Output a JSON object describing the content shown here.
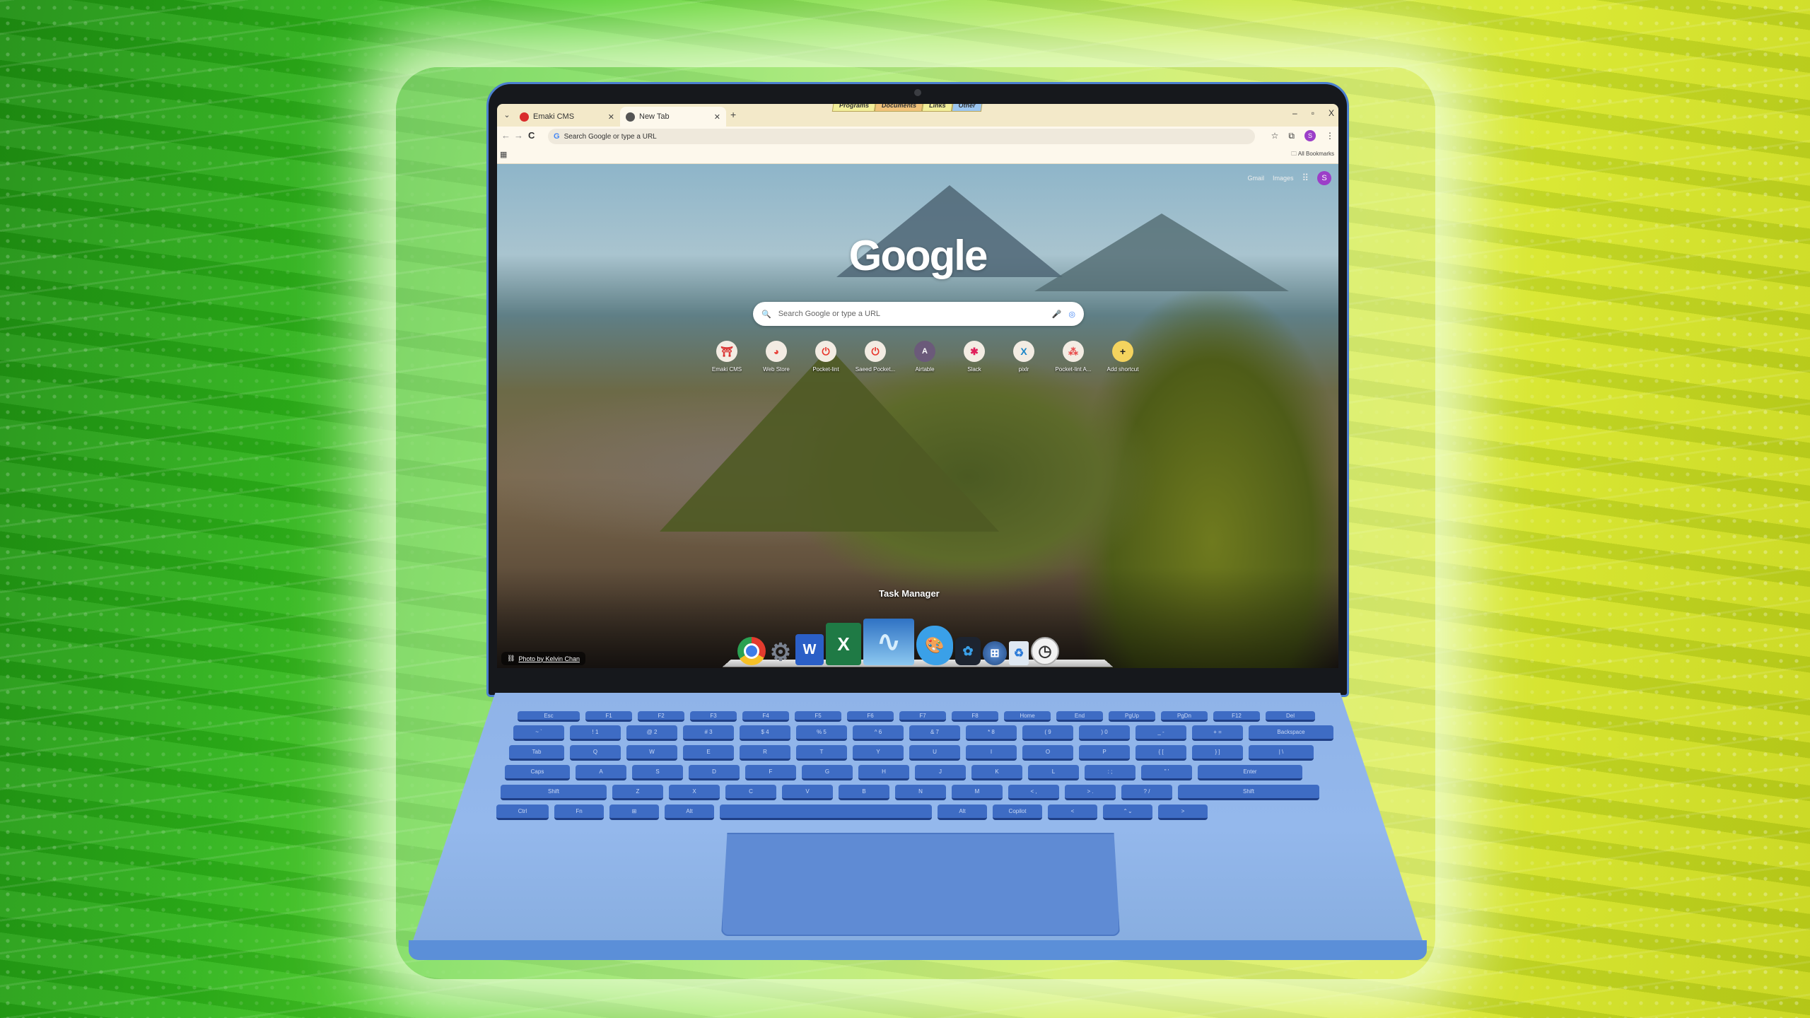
{
  "browser": {
    "tabs": [
      {
        "title": "Emaki CMS",
        "active": false,
        "favicon_color": "#d92b2b"
      },
      {
        "title": "New Tab",
        "active": true,
        "favicon_color": "#555555"
      }
    ],
    "tab_dropdown_icon": "chevron-down",
    "new_tab_icon": "+",
    "close_tab_icon": "x",
    "bookmark_folders_overlay": [
      {
        "label": "Programs",
        "color": "#f2ee9a"
      },
      {
        "label": "Documents",
        "color": "#f0c27a"
      },
      {
        "label": "Links",
        "color": "#f2ee9a"
      },
      {
        "label": "Other",
        "color": "#9cc6f0"
      }
    ],
    "window_controls": {
      "minimize": "–",
      "restore": "▫",
      "close": "X"
    },
    "nav": {
      "back": "←",
      "forward": "→",
      "reload": "C"
    },
    "omnibox": {
      "placeholder": "Search Google or type a URL",
      "value": ""
    },
    "toolbar_icons": [
      "star-icon",
      "extensions-icon",
      "profile-avatar",
      "menu-icon"
    ],
    "profile_initial": "S",
    "bookmarks_bar": {
      "all_bookmarks": "All Bookmarks"
    }
  },
  "ntp": {
    "top_links": [
      "Gmail",
      "Images"
    ],
    "profile_initial": "S",
    "logo": "Google",
    "search": {
      "placeholder": "Search Google or type a URL"
    },
    "shortcuts": [
      {
        "label": "Emaki CMS",
        "icon": "⛩",
        "color": "#d92b2b"
      },
      {
        "label": "Web Store",
        "icon": "◕",
        "color": "#e8453c"
      },
      {
        "label": "Pocket-lint",
        "icon": "⏻",
        "color": "#e8342a"
      },
      {
        "label": "Saeed Pocket...",
        "icon": "⏻",
        "color": "#e8342a"
      },
      {
        "label": "Airtable",
        "icon": "A",
        "color": "#6b5a7a"
      },
      {
        "label": "Slack",
        "icon": "✱",
        "color": "#e01e5a"
      },
      {
        "label": "pixlr",
        "icon": "X",
        "color": "#1c86c8"
      },
      {
        "label": "Pocket-lint A...",
        "icon": "⁂",
        "color": "#e84a4a"
      },
      {
        "label": "Add shortcut",
        "icon": "+",
        "color": "#222222"
      }
    ],
    "photo_credit": "Photo by Kelvin Chan"
  },
  "dock": {
    "hover_label": "Task Manager",
    "apps": [
      {
        "name": "Chrome",
        "glyph": "◉",
        "bg": "#e33b2e"
      },
      {
        "name": "Settings",
        "glyph": "⚙",
        "bg": "#7a8290"
      },
      {
        "name": "Word",
        "glyph": "W",
        "bg": "#2b5fc7"
      },
      {
        "name": "Excel",
        "glyph": "X",
        "bg": "#1f7a45"
      },
      {
        "name": "Task Manager",
        "glyph": "∿",
        "bg": "#4aa3e0"
      },
      {
        "name": "Paint",
        "glyph": "🎨",
        "bg": "#3aa0e8"
      },
      {
        "name": "Photo Editor",
        "glyph": "✿",
        "bg": "#1d2430"
      },
      {
        "name": "Windows",
        "glyph": "⊞",
        "bg": "#3560a8"
      },
      {
        "name": "Recycle Bin",
        "glyph": "♻",
        "bg": "#dfe8f2"
      },
      {
        "name": "Clock",
        "glyph": "◷",
        "bg": "#f2f2f2"
      }
    ]
  },
  "keyboard": {
    "rows": [
      [
        "Esc",
        "F1",
        "F2",
        "F3",
        "F4",
        "F5",
        "F6",
        "F7",
        "F8",
        "Home",
        "End",
        "PgUp",
        "PgDn",
        "F12",
        "Del"
      ],
      [
        "~ `",
        "! 1",
        "@ 2",
        "# 3",
        "$ 4",
        "% 5",
        "^ 6",
        "& 7",
        "* 8",
        "( 9",
        ") 0",
        "_ -",
        "+ =",
        "Backspace"
      ],
      [
        "Tab",
        "Q",
        "W",
        "E",
        "R",
        "T",
        "Y",
        "U",
        "I",
        "O",
        "P",
        "{ [",
        "} ]",
        "| \\"
      ],
      [
        "Caps",
        "A",
        "S",
        "D",
        "F",
        "G",
        "H",
        "J",
        "K",
        "L",
        ": ;",
        "\" '",
        "Enter"
      ],
      [
        "Shift",
        "Z",
        "X",
        "C",
        "V",
        "B",
        "N",
        "M",
        "< ,",
        "> .",
        "? /",
        "Shift"
      ],
      [
        "Ctrl",
        "Fn",
        "⊞",
        "Alt",
        "",
        "Alt",
        "Copilot",
        "<",
        "⌃⌄",
        ">"
      ]
    ]
  }
}
